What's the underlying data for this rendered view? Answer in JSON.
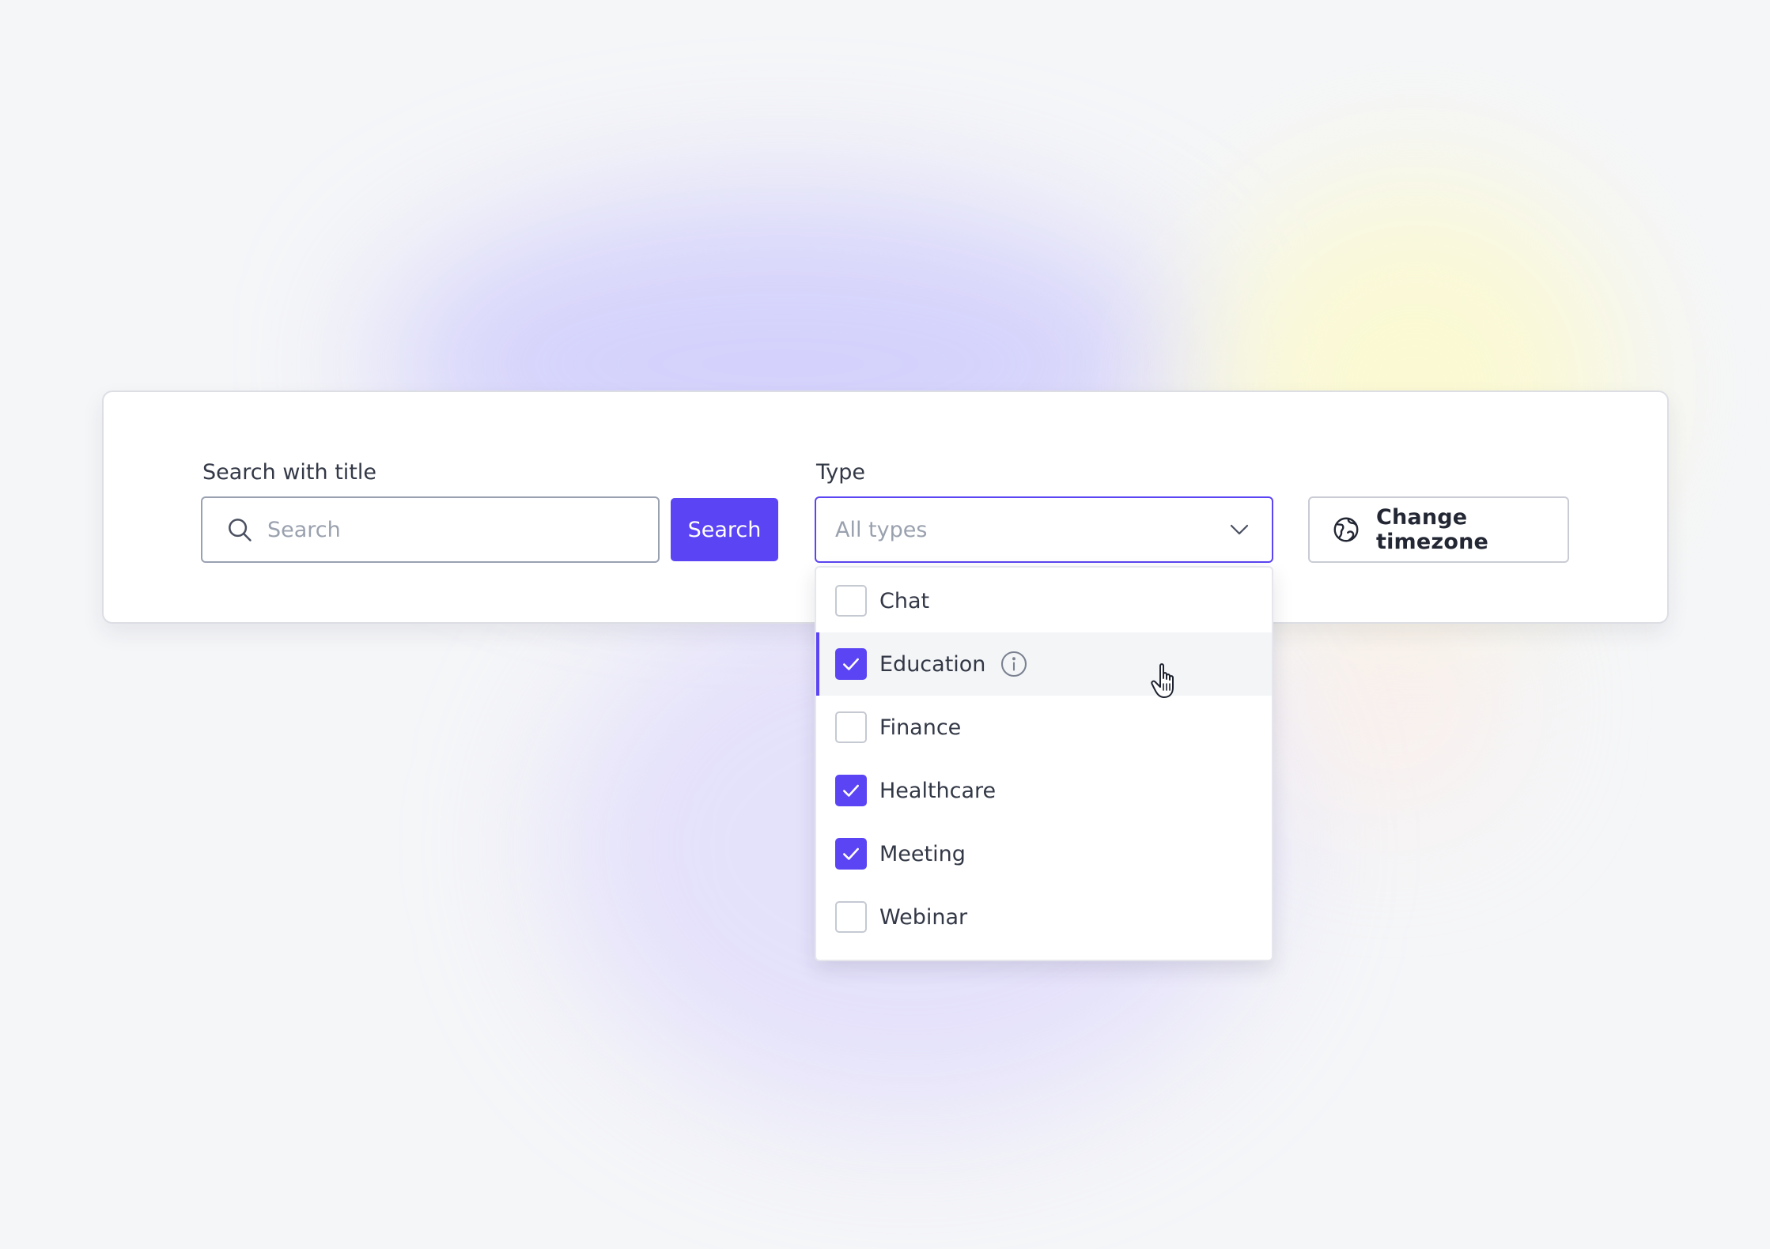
{
  "search": {
    "label": "Search with title",
    "placeholder": "Search",
    "button_label": "Search"
  },
  "type_filter": {
    "label": "Type",
    "selected_display": "All types",
    "options": [
      {
        "label": "Chat",
        "checked": false
      },
      {
        "label": "Education",
        "checked": true,
        "hovered": true,
        "has_info_icon": true
      },
      {
        "label": "Finance",
        "checked": false
      },
      {
        "label": "Healthcare",
        "checked": true
      },
      {
        "label": "Meeting",
        "checked": true
      },
      {
        "label": "Webinar",
        "checked": false
      }
    ]
  },
  "timezone_button": {
    "label": "Change timezone",
    "icon": "globe-icon"
  },
  "colors": {
    "accent": "#5b44f3",
    "background": "#f5f6f8"
  }
}
